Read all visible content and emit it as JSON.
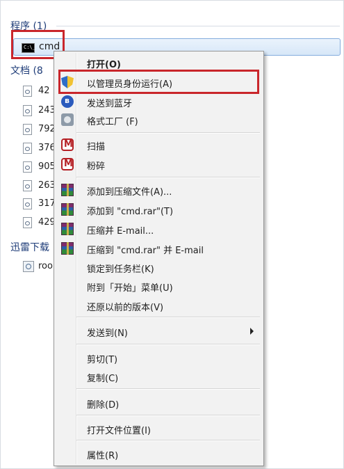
{
  "groups": {
    "programs": "程序 (1)",
    "documents": "文档 (8",
    "thunder": "迅雷下载"
  },
  "program_item": {
    "label": "cmd",
    "icon": "cmd-icon",
    "icon_text": "C:\\_"
  },
  "documents": [
    {
      "label": "42"
    },
    {
      "label": "243"
    },
    {
      "label": "792"
    },
    {
      "label": "376"
    },
    {
      "label": "905"
    },
    {
      "label": "263"
    },
    {
      "label": "317"
    },
    {
      "label": "429"
    }
  ],
  "thunder_item": {
    "label": "roo"
  },
  "context_menu": {
    "open": "打开(O)",
    "run_as_admin": "以管理员身份运行(A)",
    "send_bluetooth": "发送到蓝牙",
    "format_factory": "格式工厂 (F)",
    "scan": "扫描",
    "shred": "粉碎",
    "add_to_archive": "添加到压缩文件(A)...",
    "add_to_rar": "添加到 \"cmd.rar\"(T)",
    "compress_email": "压缩并 E-mail...",
    "compress_rar_email": "压缩到 \"cmd.rar\" 并 E-mail",
    "pin_taskbar": "锁定到任务栏(K)",
    "pin_start": "附到「开始」菜单(U)",
    "restore_versions": "还原以前的版本(V)",
    "send_to": "发送到(N)",
    "cut": "剪切(T)",
    "copy": "复制(C)",
    "delete": "删除(D)",
    "open_location": "打开文件位置(I)",
    "properties": "属性(R)"
  },
  "colors": {
    "highlight_red": "#c9262b",
    "header_blue": "#1e3c78",
    "selection_blue": "#d7e7f8"
  }
}
